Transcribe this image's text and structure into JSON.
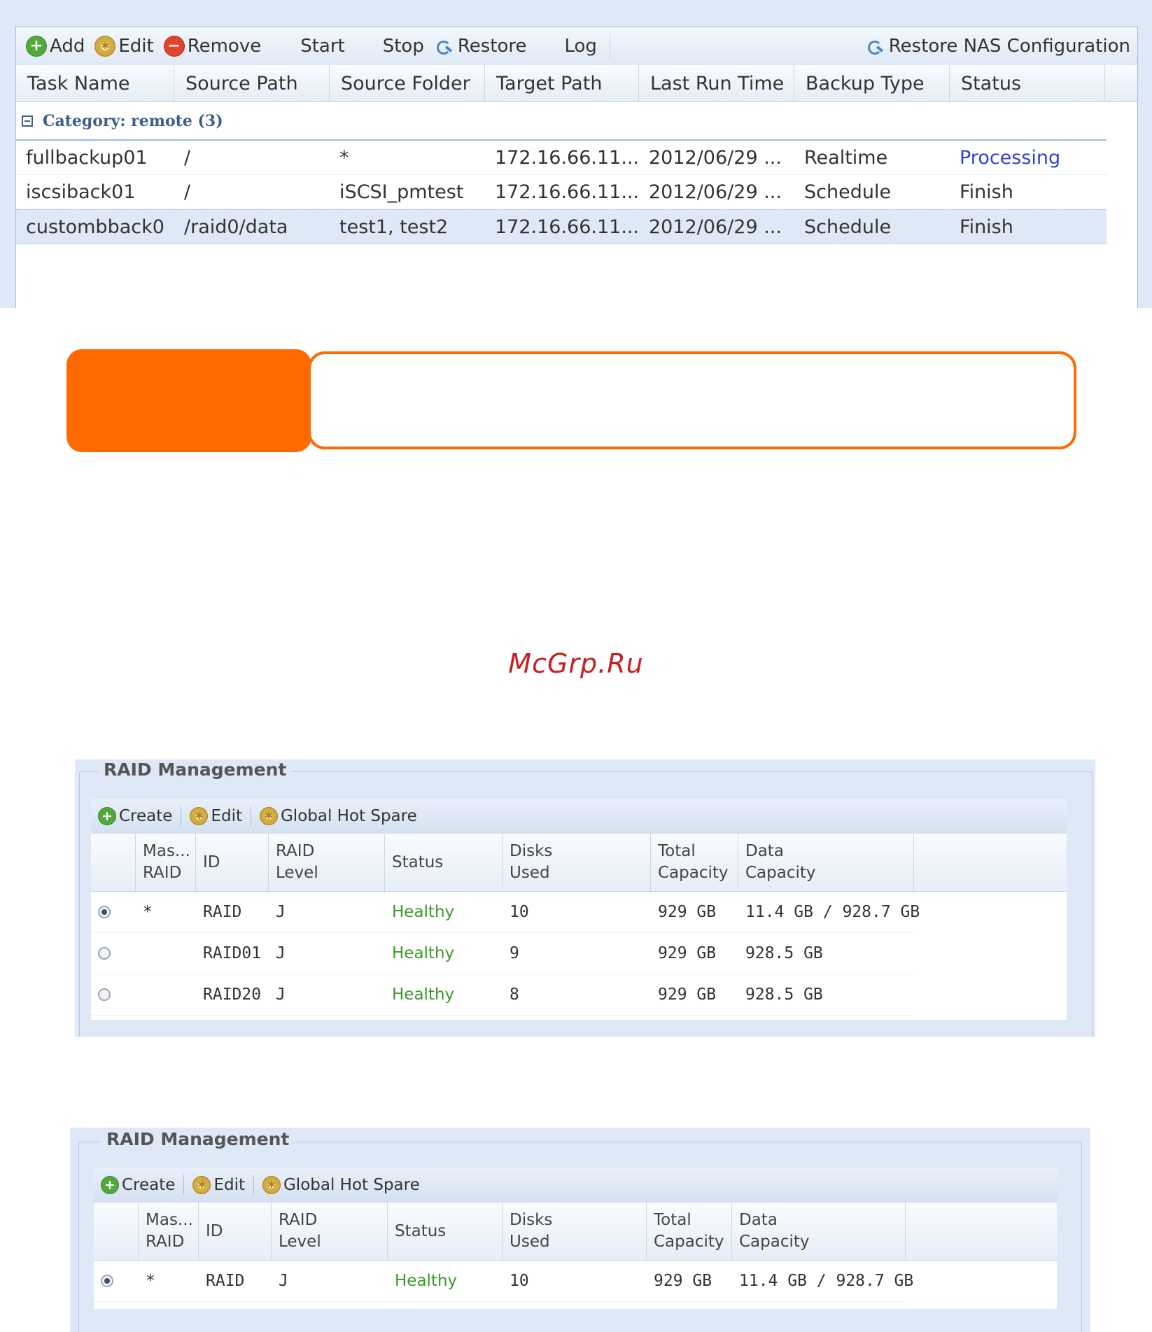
{
  "backup": {
    "toolbar": {
      "add": "Add",
      "edit": "Edit",
      "remove": "Remove",
      "start": "Start",
      "stop": "Stop",
      "restore": "Restore",
      "log": "Log",
      "restore_nas": "Restore NAS Configuration"
    },
    "columns": [
      "Task Name",
      "Source Path",
      "Source Folder",
      "Target Path",
      "Last Run Time",
      "Backup Type",
      "Status"
    ],
    "category": "Category: remote (3)",
    "rows": [
      {
        "task": "fullbackup01",
        "path": "/",
        "folder": "*",
        "target": "172.16.66.11...",
        "last_run": "2012/06/29 ...",
        "type": "Realtime",
        "status": "Processing"
      },
      {
        "task": "iscsiback01",
        "path": "/",
        "folder": "iSCSI_pmtest",
        "target": "172.16.66.11...",
        "last_run": "2012/06/29 ...",
        "type": "Schedule",
        "status": "Finish"
      },
      {
        "task": "custombback0",
        "path": "/raid0/data",
        "folder": "test1, test2",
        "target": "172.16.66.11...",
        "last_run": "2012/06/29 ...",
        "type": "Schedule",
        "status": "Finish"
      }
    ]
  },
  "watermark": "McGrp.Ru",
  "raid1": {
    "legend": "RAID Management",
    "toolbar": {
      "create": "Create",
      "edit": "Edit",
      "hot_spare": "Global Hot Spare"
    },
    "columns": {
      "master": [
        "Mas...",
        "RAID"
      ],
      "id": "ID",
      "level": [
        "RAID",
        "Level"
      ],
      "status": "Status",
      "disks": [
        "Disks",
        "Used"
      ],
      "total": [
        "Total",
        "Capacity"
      ],
      "data": [
        "Data",
        "Capacity"
      ]
    },
    "rows": [
      {
        "selected": true,
        "master": "*",
        "id": "RAID",
        "level": "J",
        "status": "Healthy",
        "disks": "10",
        "total": "929 GB",
        "data": "11.4 GB / 928.7 GB"
      },
      {
        "selected": false,
        "master": "",
        "id": "RAID01",
        "level": "J",
        "status": "Healthy",
        "disks": "9",
        "total": "929 GB",
        "data": "928.5 GB"
      },
      {
        "selected": false,
        "master": "",
        "id": "RAID20",
        "level": "J",
        "status": "Healthy",
        "disks": "8",
        "total": "929 GB",
        "data": "928.5 GB"
      }
    ]
  },
  "raid2": {
    "legend": "RAID Management",
    "toolbar": {
      "create": "Create",
      "edit": "Edit",
      "hot_spare": "Global Hot Spare"
    },
    "columns": {
      "master": [
        "Mas...",
        "RAID"
      ],
      "id": "ID",
      "level": [
        "RAID",
        "Level"
      ],
      "status": "Status",
      "disks": [
        "Disks",
        "Used"
      ],
      "total": [
        "Total",
        "Capacity"
      ],
      "data": [
        "Data",
        "Capacity"
      ]
    },
    "rows": [
      {
        "selected": true,
        "master": "*",
        "id": "RAID",
        "level": "J",
        "status": "Healthy",
        "disks": "10",
        "total": "929 GB",
        "data": "11.4 GB / 928.7 GB"
      }
    ]
  },
  "colors": {
    "accent_orange": "#ff6a00",
    "watermark_red": "#c8201e",
    "healthy_green": "#3a9a2a",
    "processing_blue": "#3344cc",
    "panel_bg": "#dfe8f6"
  }
}
